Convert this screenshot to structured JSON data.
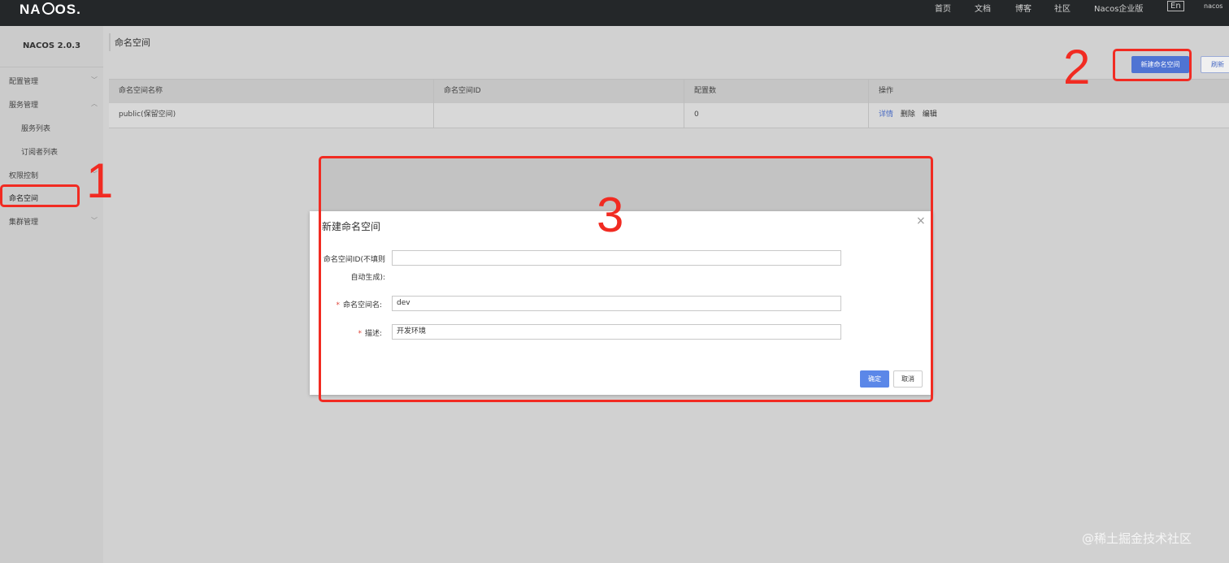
{
  "topbar": {
    "logo": {
      "pre": "NA",
      "post": "OS."
    },
    "nav": [
      "首页",
      "文档",
      "博客",
      "社区",
      "Nacos企业版"
    ],
    "lang": "En",
    "user": "nacos"
  },
  "sidebar": {
    "title": "NACOS 2.0.3",
    "items": [
      {
        "label": "配置管理",
        "expand": "﹀"
      },
      {
        "label": "服务管理",
        "expand": "︿"
      },
      {
        "label": "服务列表"
      },
      {
        "label": "订阅者列表"
      },
      {
        "label": "权限控制",
        "expand": "﹀"
      },
      {
        "label": "命名空间"
      },
      {
        "label": "集群管理",
        "expand": "﹀"
      }
    ]
  },
  "main": {
    "title": "命名空间",
    "new_button": "新建命名空间",
    "refresh_button": "刷新",
    "table": {
      "headers": [
        "命名空间名称",
        "命名空间ID",
        "配置数",
        "操作"
      ],
      "rows": [
        {
          "name": "public(保留空间)",
          "id": "",
          "count": "0",
          "actions": [
            "详情",
            "删除",
            "编辑"
          ]
        }
      ]
    }
  },
  "modal": {
    "title": "新建命名空间",
    "close_symbol": "×",
    "fields": {
      "id_label_line1": "命名空间ID(不填则",
      "id_label_line2": "自动生成):",
      "id_value": "",
      "name_label": "命名空间名:",
      "name_value": "dev",
      "desc_label": "描述:",
      "desc_value": "开发环境",
      "required_mark": "*"
    },
    "ok": "确定",
    "cancel": "取消"
  },
  "annotations": {
    "step1": "1",
    "step2": "2",
    "step3": "3"
  },
  "colors": {
    "annotation_red": "#f12b22",
    "primary_blue": "#4f74d3",
    "topbar_bg": "#242729"
  },
  "watermark": "@稀土掘金技术社区"
}
